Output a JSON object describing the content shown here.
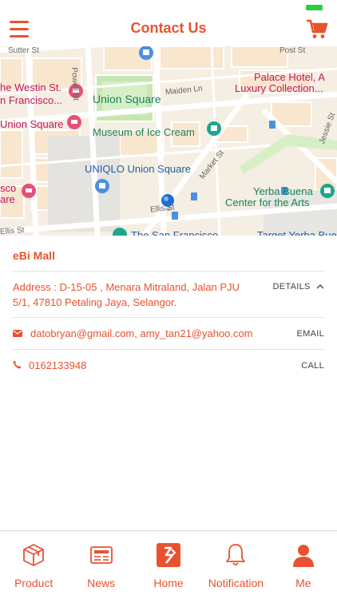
{
  "header": {
    "title": "Contact Us",
    "menu_icon": "hamburger-icon",
    "cart_icon": "cart-icon"
  },
  "map": {
    "streets": [
      "Sutter St",
      "Post St",
      "Powell St",
      "Maiden Ln",
      "Market St",
      "Ellis St",
      "Jessie St"
    ],
    "places": {
      "westin": "The Westin St. Francisco",
      "westin_line1": "he Westin St.",
      "westin_line2": "n Francisco...",
      "palace_line1": "Palace Hotel, A",
      "palace_line2": "Luxury Collection...",
      "union_square_green": "Union Square",
      "union_square_pink": "Union Square",
      "museum": "Museum of Ice Cream",
      "uniqlo": "UNIQLO Union Square",
      "yerba_line1": "Yerba Buena",
      "yerba_line2": "Center for the Arts",
      "sf_left_line1": "sco",
      "sf_left_line2": "are",
      "bottom_sf": "The San Francisco",
      "target": "Target Yerba Bue"
    }
  },
  "contact": {
    "store_name": "eBi Mall",
    "address_line1": "Address : D-15-05 , Menara Mitraland, Jalan PJU",
    "address_line2": "5/1, 47810 Petaling Jaya, Selangor.",
    "details_label": "DETAILS",
    "email": "datobryan@gmail.com, amy_tan21@yahoo.com",
    "email_label": "EMAIL",
    "phone": "0162133948",
    "call_label": "CALL"
  },
  "nav": [
    {
      "label": "Product",
      "icon": "box-icon"
    },
    {
      "label": "News",
      "icon": "newspaper-icon"
    },
    {
      "label": "Home",
      "icon": "home-logo-icon"
    },
    {
      "label": "Notification",
      "icon": "bell-icon"
    },
    {
      "label": "Me",
      "icon": "user-icon"
    }
  ],
  "colors": {
    "accent": "#e8522f",
    "map_bg": "#f5eee2",
    "park": "#c8e6b4"
  }
}
